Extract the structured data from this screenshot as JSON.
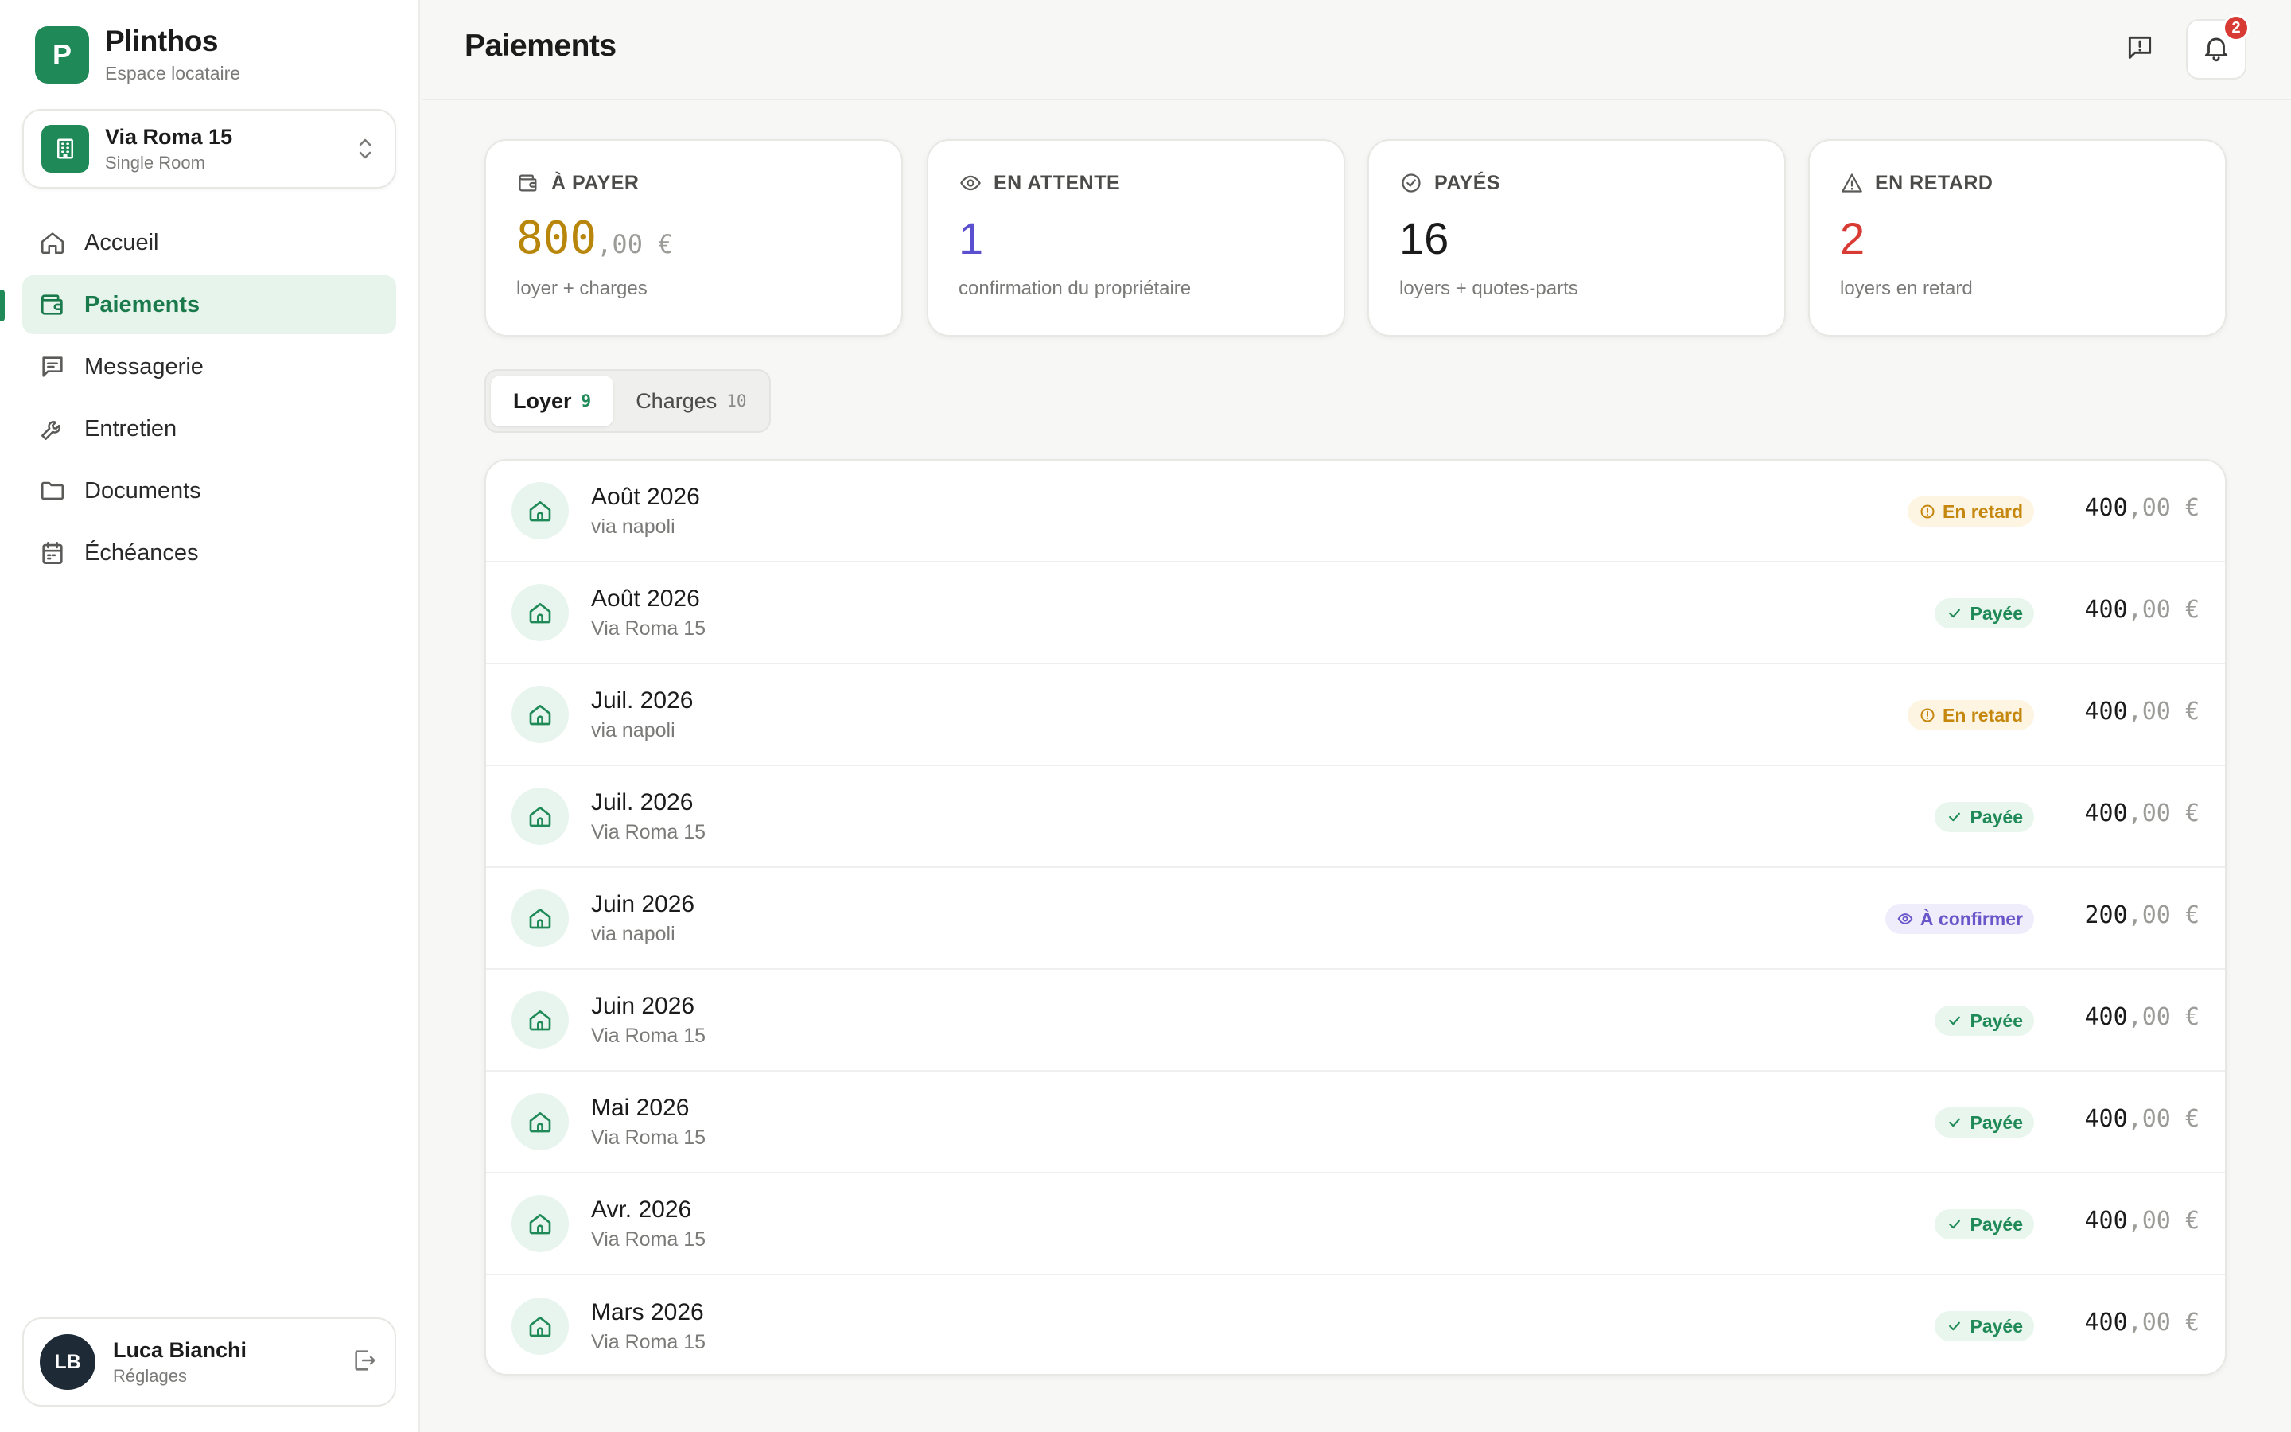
{
  "brand": {
    "logo_letter": "P",
    "name": "Plinthos",
    "subtitle": "Espace locataire"
  },
  "property": {
    "name": "Via Roma 15",
    "type": "Single Room"
  },
  "nav": [
    {
      "label": "Accueil",
      "icon": "home-icon"
    },
    {
      "label": "Paiements",
      "icon": "wallet-icon",
      "active": true
    },
    {
      "label": "Messagerie",
      "icon": "message-icon"
    },
    {
      "label": "Entretien",
      "icon": "wrench-icon"
    },
    {
      "label": "Documents",
      "icon": "folder-icon"
    },
    {
      "label": "Échéances",
      "icon": "calendar-icon"
    }
  ],
  "user": {
    "initials": "LB",
    "name": "Luca Bianchi",
    "subtitle": "Réglages"
  },
  "header": {
    "title": "Paiements",
    "notification_count": "2"
  },
  "stats": [
    {
      "label": "À PAYER",
      "value_int": "800",
      "value_frac": ",00 €",
      "desc": "loyer + charges",
      "color": "#b8860b"
    },
    {
      "label": "EN ATTENTE",
      "value_int": "1",
      "value_frac": "",
      "desc": "confirmation du propriétaire",
      "color": "#5a4fcf"
    },
    {
      "label": "PAYÉS",
      "value_int": "16",
      "value_frac": "",
      "desc": "loyers + quotes-parts",
      "color": "#1b1b1b"
    },
    {
      "label": "EN RETARD",
      "value_int": "2",
      "value_frac": "",
      "desc": "loyers en retard",
      "color": "#d73b34"
    }
  ],
  "tabs": [
    {
      "label": "Loyer",
      "count": "9",
      "active": true
    },
    {
      "label": "Charges",
      "count": "10",
      "active": false
    }
  ],
  "payments": [
    {
      "period": "Août 2026",
      "property": "via napoli",
      "status": "En retard",
      "status_type": "late",
      "amount_int": "400",
      "amount_frac": ",00",
      "currency": "€"
    },
    {
      "period": "Août 2026",
      "property": "Via Roma 15",
      "status": "Payée",
      "status_type": "paid",
      "amount_int": "400",
      "amount_frac": ",00",
      "currency": "€"
    },
    {
      "period": "Juil. 2026",
      "property": "via napoli",
      "status": "En retard",
      "status_type": "late",
      "amount_int": "400",
      "amount_frac": ",00",
      "currency": "€"
    },
    {
      "period": "Juil. 2026",
      "property": "Via Roma 15",
      "status": "Payée",
      "status_type": "paid",
      "amount_int": "400",
      "amount_frac": ",00",
      "currency": "€"
    },
    {
      "period": "Juin 2026",
      "property": "via napoli",
      "status": "À confirmer",
      "status_type": "confirm",
      "amount_int": "200",
      "amount_frac": ",00",
      "currency": "€"
    },
    {
      "period": "Juin 2026",
      "property": "Via Roma 15",
      "status": "Payée",
      "status_type": "paid",
      "amount_int": "400",
      "amount_frac": ",00",
      "currency": "€"
    },
    {
      "period": "Mai 2026",
      "property": "Via Roma 15",
      "status": "Payée",
      "status_type": "paid",
      "amount_int": "400",
      "amount_frac": ",00",
      "currency": "€"
    },
    {
      "period": "Avr. 2026",
      "property": "Via Roma 15",
      "status": "Payée",
      "status_type": "paid",
      "amount_int": "400",
      "amount_frac": ",00",
      "currency": "€"
    },
    {
      "period": "Mars 2026",
      "property": "Via Roma 15",
      "status": "Payée",
      "status_type": "paid",
      "amount_int": "400",
      "amount_frac": ",00",
      "currency": "€"
    }
  ],
  "colors": {
    "brand": "#1f8a57",
    "late": "#c6870f",
    "paid": "#1f8a57",
    "confirm": "#6a55c9",
    "danger": "#d73b34"
  }
}
